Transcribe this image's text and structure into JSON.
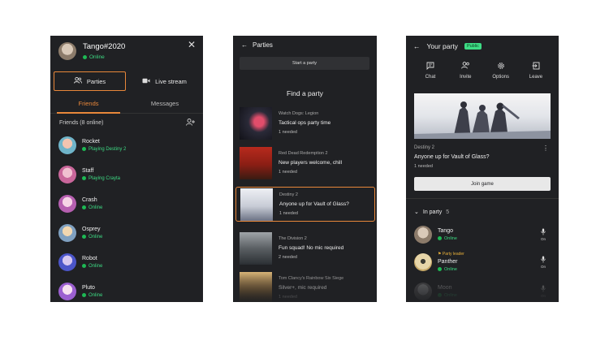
{
  "guide": {
    "user_name": "Tango#2020",
    "user_status": "Online",
    "tabs": {
      "parties": "Parties",
      "live_stream": "Live stream"
    },
    "subtabs": {
      "friends": "Friends",
      "messages": "Messages"
    },
    "friends_header": "Friends (8 online)",
    "friends": [
      {
        "name": "Rocket",
        "status": "Playing Destiny 2"
      },
      {
        "name": "Staff",
        "status": "Playing Crayta"
      },
      {
        "name": "Crash",
        "status": "Online"
      },
      {
        "name": "Osprey",
        "status": "Online"
      },
      {
        "name": "Robot",
        "status": "Online"
      },
      {
        "name": "Pluto",
        "status": "Online"
      }
    ]
  },
  "parties": {
    "title": "Parties",
    "start_label": "Start a party",
    "find_label": "Find a party",
    "list": [
      {
        "game": "Watch Dogs: Legion",
        "title": "Tactical ops party time",
        "needed": "1 needed"
      },
      {
        "game": "Red Dead Redemption 2",
        "title": "New players welcome, chill",
        "needed": "1 needed"
      },
      {
        "game": "Destiny 2",
        "title": "Anyone up for Vault of Glass?",
        "needed": "1 needed"
      },
      {
        "game": "The Division 2",
        "title": "Fun squad! No mic required",
        "needed": "2 needed"
      },
      {
        "game": "Tom Clancy's Rainbow Six Siege",
        "title": "Silver+, mic required",
        "needed": "1 needed"
      }
    ]
  },
  "your_party": {
    "title": "Your party",
    "badge": "Public",
    "actions": {
      "chat": "Chat",
      "invite": "Invite",
      "options": "Options",
      "leave": "Leave"
    },
    "game": "Destiny 2",
    "party_title": "Anyone up for Vault of Glass?",
    "needed": "1 needed",
    "join_label": "Join game",
    "in_party_label": "In party",
    "in_party_count": "5",
    "members": [
      {
        "name": "Tango",
        "status": "Online",
        "mic": "On",
        "leader": ""
      },
      {
        "name": "Panther",
        "status": "Online",
        "mic": "On",
        "leader": "Party leader"
      },
      {
        "name": "Moon",
        "status": "Online",
        "mic": "On",
        "leader": ""
      }
    ]
  },
  "colors": {
    "accent": "#e8873a",
    "online": "#3ddc84",
    "panel": "#202124"
  }
}
